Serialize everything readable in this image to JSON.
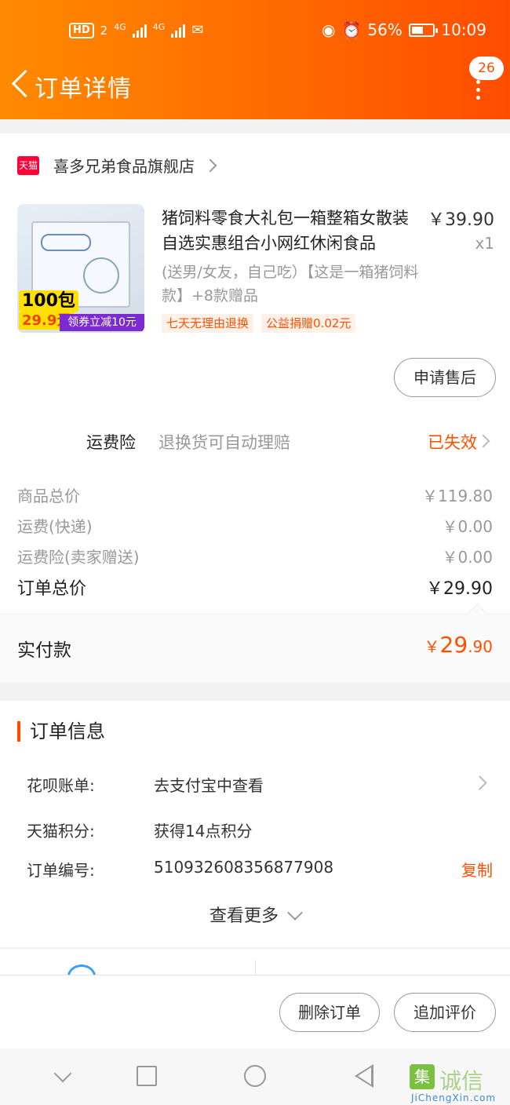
{
  "status_bar": {
    "hd": "HD",
    "hd_sub": "2",
    "net1": "4G",
    "net2": "4G",
    "battery_pct": "56%",
    "battery_level": 0.56,
    "time": "10:09"
  },
  "nav": {
    "title": "订单详情",
    "message_count": "26"
  },
  "shop": {
    "logo_text": "天猫",
    "name": "喜多兄弟食品旗舰店"
  },
  "product": {
    "image_badge": "100包",
    "image_price": "29.9元",
    "image_coupon": "领券立减10元",
    "title": "猪饲料零食大礼包一箱整箱女散装自选实惠组合小网红休闲食品",
    "price": "￥39.90",
    "qty": "x1",
    "sku": "(送男/女友，自己吃）【这是一箱猪饲料款】+8款赠品",
    "tags": [
      "七天无理由退换",
      "公益捐赠0.02元"
    ],
    "aftersale_label": "申请售后"
  },
  "insurance": {
    "label": "运费险",
    "desc": "退换货可自动理赔",
    "status": "已失效"
  },
  "fees": [
    {
      "label": "商品总价",
      "value": "￥119.80"
    },
    {
      "label": "运费(快递)",
      "value": "￥0.00"
    },
    {
      "label": "运费险(卖家赠送)",
      "value": "￥0.00"
    },
    {
      "label": "订单总价",
      "value": "￥29.90"
    }
  ],
  "paid": {
    "label": "实付款",
    "currency": "￥",
    "int": "29",
    "dec": ".90"
  },
  "order_info": {
    "title": "订单信息",
    "rows": [
      {
        "key": "花呗账单:",
        "value": "去支付宝中查看"
      },
      {
        "key": "天猫积分:",
        "value": "获得14点积分"
      },
      {
        "key": "订单编号:",
        "value": "510932608356877908"
      }
    ],
    "copy_label": "复制",
    "see_more": "查看更多"
  },
  "actions": {
    "delete_label": "删除订单",
    "review_label": "追加评价"
  },
  "watermark": {
    "icon": "集",
    "text": "诚信",
    "url": "JiChengXin.com"
  }
}
